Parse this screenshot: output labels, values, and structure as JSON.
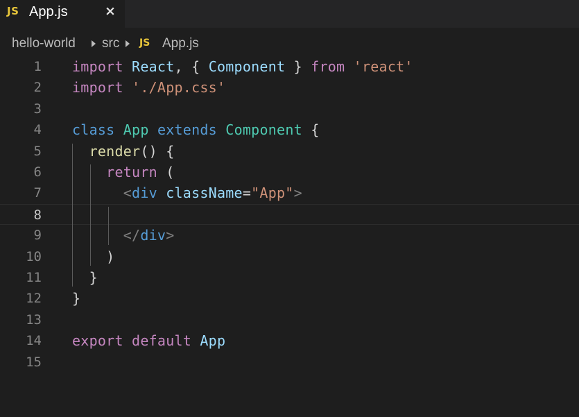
{
  "tab": {
    "icon_label": "JS",
    "title": "App.js",
    "close_glyph": "×"
  },
  "breadcrumb": {
    "items": [
      "hello-world",
      "src",
      "App.js"
    ],
    "file_icon_label": "JS"
  },
  "editor": {
    "language": "javascript",
    "active_line": 8,
    "line_numbers": [
      "1",
      "2",
      "3",
      "4",
      "5",
      "6",
      "7",
      "8",
      "9",
      "10",
      "11",
      "12",
      "13",
      "14",
      "15"
    ],
    "lines": [
      [
        {
          "t": "import",
          "c": "kw"
        },
        {
          "t": " ",
          "c": "pn"
        },
        {
          "t": "React",
          "c": "vr"
        },
        {
          "t": ", { ",
          "c": "pn"
        },
        {
          "t": "Component",
          "c": "vr"
        },
        {
          "t": " } ",
          "c": "pn"
        },
        {
          "t": "from",
          "c": "kw"
        },
        {
          "t": " ",
          "c": "pn"
        },
        {
          "t": "'react'",
          "c": "st"
        }
      ],
      [
        {
          "t": "import",
          "c": "kw"
        },
        {
          "t": " ",
          "c": "pn"
        },
        {
          "t": "'./App.css'",
          "c": "st"
        }
      ],
      [],
      [
        {
          "t": "class",
          "c": "kb"
        },
        {
          "t": " ",
          "c": "pn"
        },
        {
          "t": "App",
          "c": "ty"
        },
        {
          "t": " ",
          "c": "pn"
        },
        {
          "t": "extends",
          "c": "kb"
        },
        {
          "t": " ",
          "c": "pn"
        },
        {
          "t": "Component",
          "c": "ty"
        },
        {
          "t": " {",
          "c": "pn"
        }
      ],
      [
        {
          "t": "  ",
          "c": "pn"
        },
        {
          "t": "render",
          "c": "fn"
        },
        {
          "t": "() {",
          "c": "pn"
        }
      ],
      [
        {
          "t": "    ",
          "c": "pn"
        },
        {
          "t": "return",
          "c": "kw"
        },
        {
          "t": " (",
          "c": "pn"
        }
      ],
      [
        {
          "t": "      ",
          "c": "pn"
        },
        {
          "t": "<",
          "c": "tg"
        },
        {
          "t": "div",
          "c": "tn"
        },
        {
          "t": " ",
          "c": "pn"
        },
        {
          "t": "className",
          "c": "vr"
        },
        {
          "t": "=",
          "c": "pn"
        },
        {
          "t": "\"App\"",
          "c": "st"
        },
        {
          "t": ">",
          "c": "tg"
        }
      ],
      [],
      [
        {
          "t": "      ",
          "c": "pn"
        },
        {
          "t": "</",
          "c": "tg"
        },
        {
          "t": "div",
          "c": "tn"
        },
        {
          "t": ">",
          "c": "tg"
        }
      ],
      [
        {
          "t": "    )",
          "c": "pn"
        }
      ],
      [
        {
          "t": "  }",
          "c": "pn"
        }
      ],
      [
        {
          "t": "}",
          "c": "pn"
        }
      ],
      [],
      [
        {
          "t": "export",
          "c": "kw"
        },
        {
          "t": " ",
          "c": "pn"
        },
        {
          "t": "default",
          "c": "kw"
        },
        {
          "t": " ",
          "c": "pn"
        },
        {
          "t": "App",
          "c": "vr"
        }
      ],
      []
    ]
  },
  "colors": {
    "editor_background": "#1e1e1e",
    "tab_bar_background": "#252526",
    "js_icon": "#e8c63a",
    "keyword_control": "#c586c0",
    "keyword_storage": "#569cd6",
    "type_name": "#4ec9b0",
    "variable": "#9cdcfe",
    "string": "#ce9178",
    "function": "#dcdcaa",
    "punctuation": "#d4d4d4",
    "line_number": "#858585"
  }
}
